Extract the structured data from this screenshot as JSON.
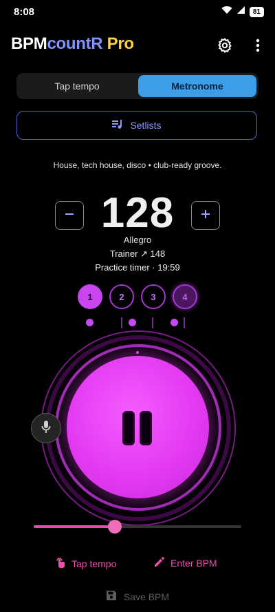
{
  "status_bar": {
    "time": "8:08",
    "battery": "81"
  },
  "app": {
    "title_part1": "BPM",
    "title_part2": "countR",
    "title_part3": " Pro"
  },
  "tabs": [
    {
      "label": "Tap tempo",
      "selected": false
    },
    {
      "label": "Metronome",
      "selected": true
    }
  ],
  "setlists": {
    "label": "Setlists"
  },
  "genre_description": "House, tech house, disco • club-ready groove.",
  "tempo": {
    "bpm": "128",
    "name": "Allegro",
    "trainer": "Trainer ↗ 148",
    "practice_timer": "Practice timer · 19:59"
  },
  "beats": [
    {
      "label": "1",
      "state": "active"
    },
    {
      "label": "2",
      "state": "inactive"
    },
    {
      "label": "3",
      "state": "inactive"
    },
    {
      "label": "4",
      "state": "accent"
    }
  ],
  "volume_level": 0.39,
  "actions": {
    "tap_tempo": "Tap tempo",
    "enter_bpm": "Enter BPM",
    "save_bpm": "Save BPM"
  },
  "colors": {
    "accent_magenta": "#e43af2",
    "accent_blue": "#3b9ee9",
    "accent_pink": "#f04da8"
  },
  "icons": [
    "wifi-icon",
    "signal-icon",
    "battery-icon",
    "settings-icon",
    "more-vert-icon",
    "playlist-icon",
    "minus-icon",
    "plus-icon",
    "mic-icon",
    "pause-icon",
    "tap-icon",
    "pencil-icon",
    "save-icon"
  ]
}
